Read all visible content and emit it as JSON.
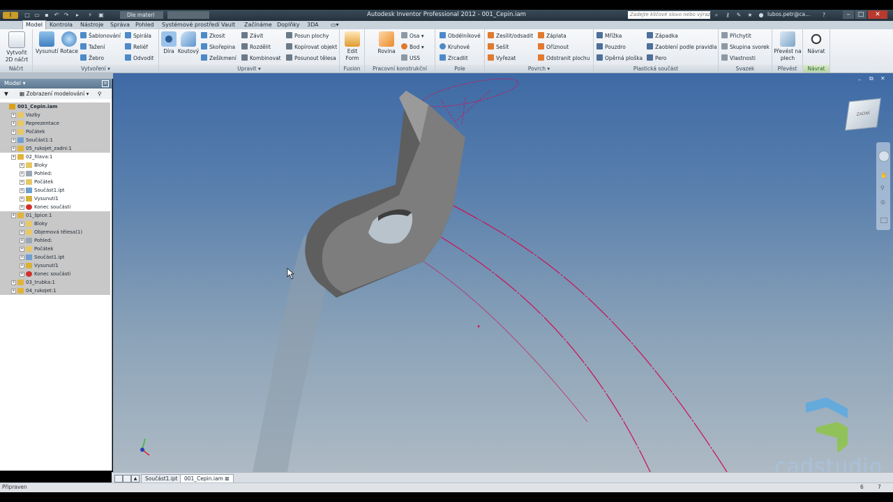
{
  "app": {
    "title": "Autodesk Inventor Professional 2012 - 001_Cepin.iam",
    "material_select": "Dle materi",
    "search_placeholder": "Zadejte klíčové slovo nebo výraz.",
    "user": "lubos.petr@ca..."
  },
  "tabs": [
    {
      "label": "Model",
      "active": true
    },
    {
      "label": "Kontrola"
    },
    {
      "label": "Nástroje"
    },
    {
      "label": "Správa"
    },
    {
      "label": "Pohled"
    },
    {
      "label": "Systémové prostředí"
    },
    {
      "label": "Vault"
    },
    {
      "label": "Začínáme"
    },
    {
      "label": "Doplňky"
    },
    {
      "label": "3DA"
    }
  ],
  "ribbon": {
    "nacrt": {
      "create_2d": "Vytvořit 2D náčrt",
      "label": "Náčrt"
    },
    "vytvoreni": {
      "vysunuti": "Vysunutí",
      "rotace": "Rotace",
      "sablonovani": "Šablonování",
      "tazeni": "Tažení",
      "zebro": "Žebro",
      "spirala": "Spirála",
      "relief": "Reliéf",
      "odvodit": "Odvodit",
      "label": "Vytvoření"
    },
    "upravit": {
      "dira": "Díra",
      "koutovy": "Koutový",
      "zkosit": "Zkosit",
      "skorepina": "Skořepina",
      "zeslikmeni": "Zešikmení",
      "zavit": "Závit",
      "rozdelit": "Rozdělit",
      "kombinovat": "Kombinovat",
      "posun_plochy": "Posun plochy",
      "kopirovat_objekt": "Kopírovat objekt",
      "posunout_telesa": "Posunout tělesa",
      "label": "Upravit"
    },
    "fusion": {
      "edit_form": "Edit Form",
      "label": "Fusion"
    },
    "pracovni": {
      "rovina": "Rovina",
      "osa": "Osa",
      "bod": "Bod",
      "uss": "USS",
      "label": "Pracovní konstrukční prvky"
    },
    "pole": {
      "obdelnikove": "Obdélníkové",
      "kruhove": "Kruhové",
      "zrcadlit": "Zrcadlit",
      "label": "Pole"
    },
    "povrch": {
      "zesilit": "Zesílit/odsadit",
      "sesit": "Sešít",
      "vyrezat": "Vyřezat",
      "zaplata": "Záplata",
      "oriznout": "Oříznout",
      "odstranit": "Odstranit plochu",
      "label": "Povrch"
    },
    "plasticka": {
      "mrizka": "Mřížka",
      "pouzdro": "Pouzdro",
      "operna": "Opěrná ploška",
      "zapadka": "Západka",
      "zaobleni": "Zaoblení podle pravidla",
      "pero": "Pero",
      "label": "Plastická součást"
    },
    "svazek": {
      "prichytit": "Přichytit",
      "skupina": "Skupina svorek",
      "vlastnosti": "Vlastnosti",
      "label": "Svazek"
    },
    "prevest": {
      "prevest_na_plech": "Převést na plech",
      "label": "Převést"
    },
    "navrat": {
      "navrat": "Návrat",
      "label": "Návrat"
    }
  },
  "browser": {
    "title": "Model",
    "view_select": "Zobrazení modelování",
    "tree": [
      {
        "label": "001_Cepin.iam",
        "level": 0,
        "bold": true,
        "dim": true,
        "icon": "assembly"
      },
      {
        "label": "Vazby",
        "level": 1,
        "dim": true,
        "icon": "folder"
      },
      {
        "label": "Reprezentace",
        "level": 1,
        "dim": true,
        "icon": "folder"
      },
      {
        "label": "Počátek",
        "level": 1,
        "dim": true,
        "icon": "folder"
      },
      {
        "label": "Součást1:1",
        "level": 1,
        "dim": true,
        "icon": "part"
      },
      {
        "label": "05_rukojet_zadni:1",
        "level": 1,
        "dim": true,
        "icon": "component"
      },
      {
        "label": "02_hlava:1",
        "level": 1,
        "dim": false,
        "icon": "component"
      },
      {
        "label": "Bloky",
        "level": 2,
        "dim": false,
        "icon": "folder"
      },
      {
        "label": "Pohled:",
        "level": 2,
        "dim": false,
        "icon": "view"
      },
      {
        "label": "Počátek",
        "level": 2,
        "dim": false,
        "icon": "folder"
      },
      {
        "label": "Součást1.ipt",
        "level": 2,
        "dim": false,
        "icon": "part"
      },
      {
        "label": "Vysunutí1",
        "level": 2,
        "dim": false,
        "icon": "extrude"
      },
      {
        "label": "Konec součásti",
        "level": 2,
        "dim": false,
        "icon": "end"
      },
      {
        "label": "01_špice:1",
        "level": 1,
        "dim": true,
        "icon": "component"
      },
      {
        "label": "Bloky",
        "level": 2,
        "dim": true,
        "icon": "folder"
      },
      {
        "label": "Objemová tělesa(1)",
        "level": 2,
        "dim": true,
        "icon": "folder"
      },
      {
        "label": "Pohled:",
        "level": 2,
        "dim": true,
        "icon": "view"
      },
      {
        "label": "Počátek",
        "level": 2,
        "dim": true,
        "icon": "folder"
      },
      {
        "label": "Součást1.ipt",
        "level": 2,
        "dim": true,
        "icon": "part"
      },
      {
        "label": "Vysunutí1",
        "level": 2,
        "dim": true,
        "icon": "extrude"
      },
      {
        "label": "Konec součásti",
        "level": 2,
        "dim": true,
        "icon": "end"
      },
      {
        "label": "03_trubka:1",
        "level": 1,
        "dim": true,
        "icon": "component"
      },
      {
        "label": "04_rukojet:1",
        "level": 1,
        "dim": true,
        "icon": "component"
      }
    ]
  },
  "viewcube": {
    "face_label": "ZADNÍ"
  },
  "documents": [
    {
      "label": "Součást1.ipt",
      "active": false
    },
    {
      "label": "001_Cepin.iam",
      "active": true
    }
  ],
  "status": {
    "text": "Připraven",
    "num1": "6",
    "num2": "7"
  },
  "watermark": {
    "text": "cadstudio"
  },
  "colors": {
    "viewport_top": "#3e6aa5",
    "viewport_bottom": "#aebac4",
    "sketch": "#c8185a",
    "model": "#7a7a7a"
  }
}
